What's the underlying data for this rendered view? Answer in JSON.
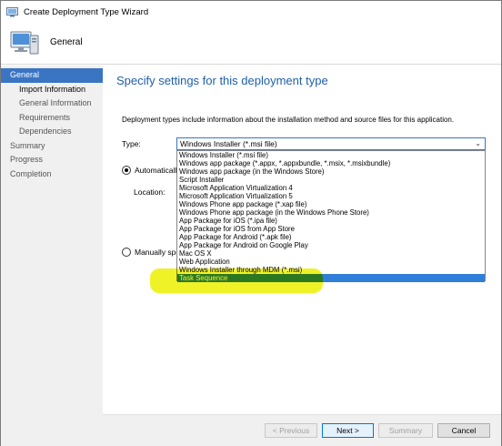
{
  "window": {
    "title": "Create Deployment Type Wizard"
  },
  "header": {
    "title": "General"
  },
  "nav": {
    "items": [
      {
        "label": "General"
      },
      {
        "label": "Import Information"
      },
      {
        "label": "General Information"
      },
      {
        "label": "Requirements"
      },
      {
        "label": "Dependencies"
      },
      {
        "label": "Summary"
      },
      {
        "label": "Progress"
      },
      {
        "label": "Completion"
      }
    ]
  },
  "main": {
    "title": "Specify settings for this deployment type",
    "description": "Deployment types include information about the installation method and source files for this application.",
    "type_label": "Type:",
    "type_selected": "Windows Installer (*.msi file)",
    "auto_label": "Automatically identify information about this deployment type from installation files",
    "location_label": "Location:",
    "manual_label": "Manually specify the deployment type information",
    "type_options": [
      "Windows Installer (*.msi file)",
      "Windows app package (*.appx, *.appxbundle, *.msix, *.msixbundle)",
      "Windows app package (in the Windows Store)",
      "Script Installer",
      "Microsoft Application Virtualization 4",
      "Microsoft Application Virtualization 5",
      "Windows Phone app package (*.xap file)",
      "Windows Phone app package (in the Windows Phone Store)",
      "App Package for iOS (*.ipa file)",
      "App Package for iOS from App Store",
      "App Package for Android (*.apk file)",
      "App Package for Android on Google Play",
      "Mac OS X",
      "Web Application",
      "Windows Installer through MDM (*.msi)",
      "Task Sequence"
    ]
  },
  "footer": {
    "previous": "< Previous",
    "next": "Next >",
    "summary": "Summary",
    "cancel": "Cancel"
  },
  "colors": {
    "accent": "#3a75c4",
    "title_blue": "#1f5fa8",
    "highlight_yellow": "#ecf000",
    "selection_blue": "#2f7ed8"
  }
}
